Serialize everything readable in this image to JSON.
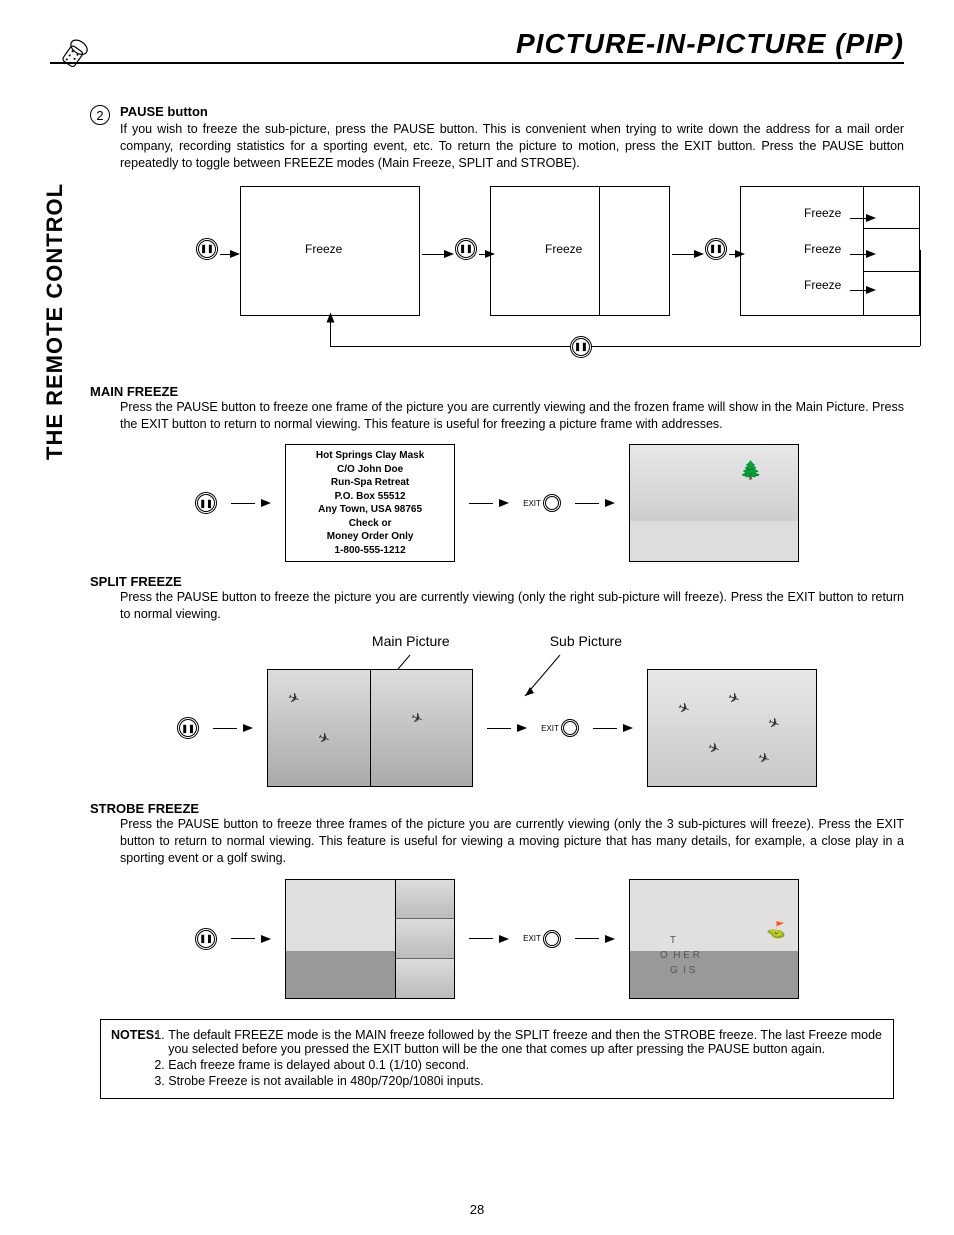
{
  "header": {
    "title": "PICTURE-IN-PICTURE (PIP)"
  },
  "sidebar": {
    "label": "THE REMOTE CONTROL"
  },
  "step": {
    "number": "2",
    "title": "PAUSE button",
    "body": "If you wish to freeze the sub-picture, press the PAUSE button. This is convenient when trying to write down the address for a mail order company, recording statistics for a sporting event, etc.  To return the picture to motion, press the EXIT button.  Press the PAUSE button repeatedly to toggle between FREEZE modes (Main Freeze, SPLIT and STROBE)."
  },
  "diagram1": {
    "label_freeze": "Freeze",
    "labels_three": [
      "Freeze",
      "Freeze",
      "Freeze"
    ]
  },
  "pause_glyph": "❚❚",
  "exit_label": "EXIT",
  "sections": {
    "main_freeze": {
      "title": "MAIN FREEZE",
      "body": "Press the PAUSE button to freeze one frame of the picture you are currently viewing and the frozen frame will show in the Main Picture.  Press the EXIT button to return to normal viewing.  This feature is useful for freezing a picture frame with addresses.",
      "address": [
        "Hot Springs Clay Mask",
        "C/O John Doe",
        "Run-Spa Retreat",
        "P.O. Box 55512",
        "Any Town, USA 98765",
        "Check or",
        "Money Order Only",
        "1-800-555-1212"
      ]
    },
    "split_freeze": {
      "title": "SPLIT FREEZE",
      "body": "Press the PAUSE button to freeze the picture you are currently viewing (only the right sub-picture will freeze).  Press the EXIT button to return to normal viewing.",
      "main_label": "Main Picture",
      "sub_label": "Sub Picture"
    },
    "strobe_freeze": {
      "title": "STROBE FREEZE",
      "body": "Press the PAUSE button to freeze three frames of the picture you are currently viewing (only the 3 sub-pictures will freeze). Press the EXIT button to return to normal viewing. This feature is useful for viewing a moving picture that has many details, for example, a close play in a sporting event or a golf swing."
    }
  },
  "notes": {
    "label": "NOTES:",
    "items": [
      "The default FREEZE mode is the MAIN freeze followed by the SPLIT freeze and then the STROBE freeze.  The last Freeze mode you selected before you pressed the EXIT button will be the one that comes up after pressing the PAUSE button again.",
      "Each freeze frame is delayed about 0.1 (1/10) second.",
      "Strobe Freeze is not available in 480p/720p/1080i inputs."
    ]
  },
  "page_number": "28"
}
